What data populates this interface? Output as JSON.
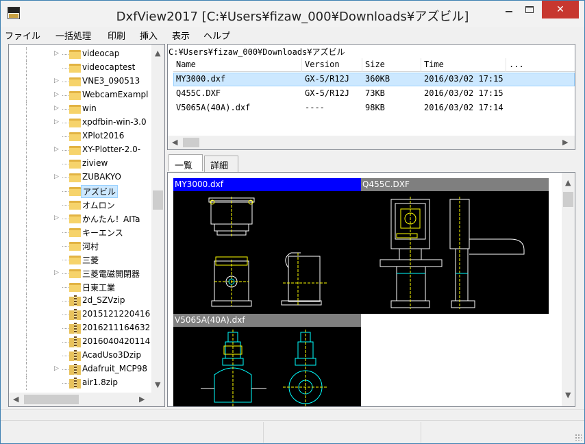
{
  "window": {
    "title": "DxfView2017 [C:¥Users¥fizaw_000¥Downloads¥アズビル]",
    "close_glyph": "✕",
    "icon": "dxfview-app-icon"
  },
  "menu": [
    "ファイル",
    "一括処理",
    "印刷",
    "挿入",
    "表示",
    "ヘルプ"
  ],
  "tree": {
    "items": [
      {
        "label": "videocap",
        "kind": "folder",
        "expandable": true
      },
      {
        "label": "videocaptest",
        "kind": "folder",
        "expandable": false
      },
      {
        "label": "VNE3_090513",
        "kind": "folder",
        "expandable": true
      },
      {
        "label": "WebcamExampl",
        "kind": "folder",
        "expandable": true
      },
      {
        "label": "win",
        "kind": "folder",
        "expandable": true
      },
      {
        "label": "xpdfbin-win-3.0",
        "kind": "folder",
        "expandable": true
      },
      {
        "label": "XPlot2016",
        "kind": "folder",
        "expandable": false
      },
      {
        "label": "XY-Plotter-2.0-",
        "kind": "folder",
        "expandable": true
      },
      {
        "label": "ziview",
        "kind": "folder",
        "expandable": false
      },
      {
        "label": "ZUBAKYO",
        "kind": "folder",
        "expandable": true
      },
      {
        "label": "アズビル",
        "kind": "folder",
        "expandable": false,
        "selected": true
      },
      {
        "label": "オムロン",
        "kind": "folder",
        "expandable": false
      },
      {
        "label": "かんたん！AITa",
        "kind": "folder",
        "expandable": true
      },
      {
        "label": "キーエンス",
        "kind": "folder",
        "expandable": false
      },
      {
        "label": "河村",
        "kind": "folder",
        "expandable": false
      },
      {
        "label": "三菱",
        "kind": "folder",
        "expandable": false
      },
      {
        "label": "三菱電磁開閉器",
        "kind": "folder",
        "expandable": true
      },
      {
        "label": "日東工業",
        "kind": "folder",
        "expandable": false
      },
      {
        "label": "2d_SZVzip",
        "kind": "zip",
        "expandable": false
      },
      {
        "label": "2015121220416",
        "kind": "zip",
        "expandable": false
      },
      {
        "label": "2016211164632",
        "kind": "zip",
        "expandable": false
      },
      {
        "label": "2016040420114",
        "kind": "zip",
        "expandable": false
      },
      {
        "label": "AcadUso3Dzip",
        "kind": "zip",
        "expandable": false
      },
      {
        "label": "Adafruit_MCP98",
        "kind": "zip",
        "expandable": true
      },
      {
        "label": "air1.8zip",
        "kind": "zip",
        "expandable": false
      }
    ]
  },
  "path": "C:¥Users¥fizaw_000¥Downloads¥アズビル",
  "file_list": {
    "columns": [
      "Name",
      "Version",
      "Size",
      "Time",
      "..."
    ],
    "rows": [
      {
        "name": "MY3000.dxf",
        "version": "GX-5/R12J",
        "size": "360KB",
        "time": "2016/03/02 17:15",
        "selected": true
      },
      {
        "name": "Q455C.DXF",
        "version": "GX-5/R12J",
        "size": "73KB",
        "time": "2016/03/02 17:15",
        "selected": false
      },
      {
        "name": "V5065A(40A).dxf",
        "version": "----",
        "size": "98KB",
        "time": "2016/03/02 17:14",
        "selected": false
      }
    ]
  },
  "tabs": [
    {
      "label": "一覧",
      "active": true
    },
    {
      "label": "詳細",
      "active": false
    }
  ],
  "previews": [
    {
      "title": "MY3000.dxf",
      "selected": true
    },
    {
      "title": "Q455C.DXF",
      "selected": false
    },
    {
      "title": "V5065A(40A).dxf",
      "selected": false
    }
  ],
  "colors": {
    "selection": "#cce8ff",
    "preview_selected": "#0000ff",
    "cad_white": "#ffffff",
    "cad_yellow": "#ffff00",
    "cad_cyan": "#00ffff",
    "close_button": "#c7372f"
  },
  "status": [
    "",
    ""
  ]
}
